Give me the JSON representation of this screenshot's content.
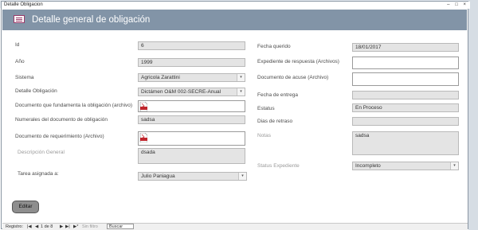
{
  "window": {
    "title": "Detalle Obligacion",
    "controls": [
      "–",
      "□",
      "×"
    ]
  },
  "header": {
    "icon": "form-icon",
    "title": "Detalle general de obligación"
  },
  "left": {
    "id": {
      "label": "Id",
      "value": "6"
    },
    "anio": {
      "label": "Año",
      "value": "1999"
    },
    "sistema": {
      "label": "Sistema",
      "value": "Agricola Zarattini"
    },
    "detalle": {
      "label": "Detalle Obligación",
      "value": "Dictámen O&M 002-SECRE-Anual"
    },
    "doc_fundamenta": {
      "label": "Documento que fundamenta la obligación (archivo)",
      "icon": "pdf-icon"
    },
    "numerales": {
      "label": "Numerales del documento de obligación",
      "value": "sadsa"
    },
    "doc_requerimiento": {
      "label": "Documento de requerimiento (Archivo)",
      "icon": "pdf-icon"
    },
    "descripcion": {
      "label": "Descripción General",
      "value": "dsada"
    },
    "tarea": {
      "label": "Tarea asignada a:",
      "value": "Julio Paniagua"
    }
  },
  "right": {
    "fecha_querido": {
      "label": "Fecha querido",
      "value": "18/01/2017"
    },
    "expediente_resp": {
      "label": "Expediente de respuesta (Archivos)",
      "value": ""
    },
    "doc_acuse": {
      "label": "Documento de acuse (Archivo)",
      "value": ""
    },
    "fecha_entrega": {
      "label": "Fecha de entrega",
      "value": ""
    },
    "estatus": {
      "label": "Estatus",
      "value": "En Proceso"
    },
    "dias_retraso": {
      "label": "Dias de retraso",
      "value": ""
    },
    "notas": {
      "label": "Notas",
      "value": "sadsa"
    },
    "status_expediente": {
      "label": "Status Expediente",
      "value": "Incompleto"
    }
  },
  "buttons": {
    "editar": "Editar"
  },
  "navigation": {
    "registro_label": "Registro:",
    "first": "|◀",
    "prev": "◀",
    "position": "1 de 8",
    "next": "▶",
    "last": "▶|",
    "new": "▶*",
    "filter": "Sin filtro",
    "search": "Buscar"
  },
  "colors": {
    "header_bg": "#8294a7",
    "field_bg": "#e4e4e4",
    "button_bg": "#8e8e8e"
  }
}
